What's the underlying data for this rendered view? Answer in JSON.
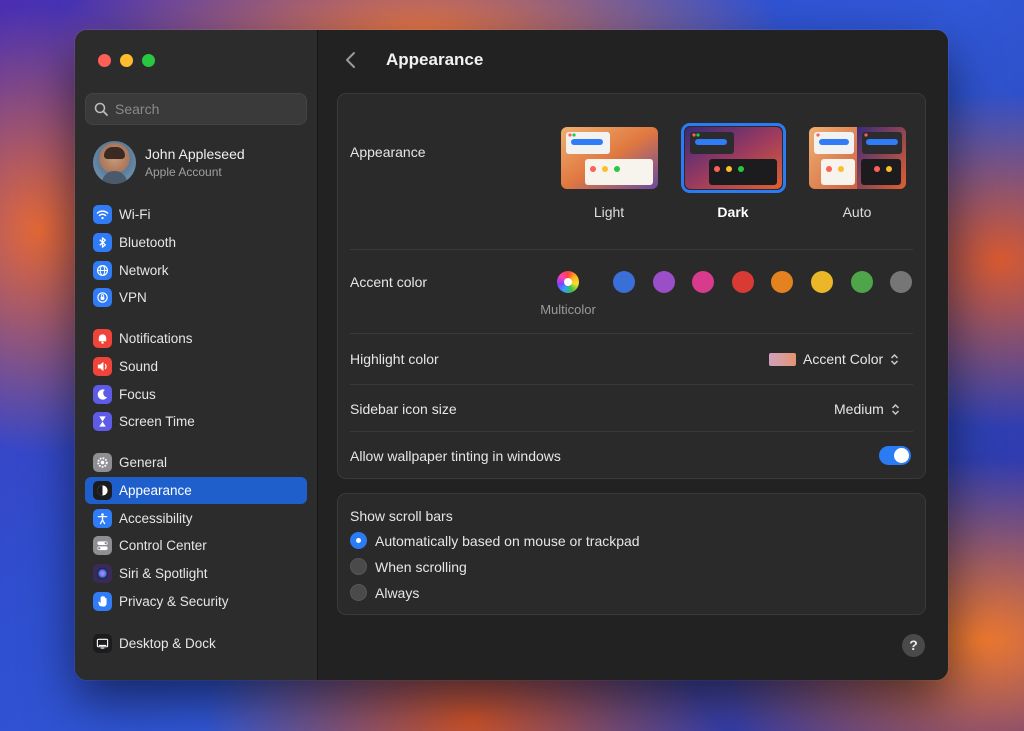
{
  "window": {
    "title": "Appearance"
  },
  "search": {
    "placeholder": "Search"
  },
  "account": {
    "name": "John Appleseed",
    "subtitle": "Apple Account"
  },
  "sidebar": {
    "group1": [
      {
        "label": "Wi-Fi",
        "icon": "wifi-icon",
        "color": "#2f7cf6"
      },
      {
        "label": "Bluetooth",
        "icon": "bluetooth-icon",
        "color": "#2f7cf6"
      },
      {
        "label": "Network",
        "icon": "globe-icon",
        "color": "#2f7cf6"
      },
      {
        "label": "VPN",
        "icon": "vpn-icon",
        "color": "#2f7cf6"
      }
    ],
    "group2": [
      {
        "label": "Notifications",
        "icon": "bell-icon",
        "color": "#f0443a"
      },
      {
        "label": "Sound",
        "icon": "speaker-icon",
        "color": "#f0443a"
      },
      {
        "label": "Focus",
        "icon": "moon-icon",
        "color": "#5e5ce6"
      },
      {
        "label": "Screen Time",
        "icon": "hourglass-icon",
        "color": "#5e5ce6"
      }
    ],
    "group3": [
      {
        "label": "General",
        "icon": "gear-icon",
        "color": "#8e8e93"
      },
      {
        "label": "Appearance",
        "icon": "appearance-icon",
        "color": "#1c1c1e",
        "active": true
      },
      {
        "label": "Accessibility",
        "icon": "accessibility-icon",
        "color": "#2f7cf6"
      },
      {
        "label": "Control Center",
        "icon": "toggles-icon",
        "color": "#8e8e93"
      },
      {
        "label": "Siri & Spotlight",
        "icon": "siri-icon",
        "color": "#3a2a5a"
      },
      {
        "label": "Privacy & Security",
        "icon": "hand-icon",
        "color": "#2f7cf6"
      }
    ],
    "group4": [
      {
        "label": "Desktop & Dock",
        "icon": "dock-icon",
        "color": "#1c1c1e"
      }
    ]
  },
  "appearance": {
    "label": "Appearance",
    "options": [
      "Light",
      "Dark",
      "Auto"
    ],
    "selected": "Dark"
  },
  "accent": {
    "label": "Accent color",
    "multicolor_label": "Multicolor",
    "colors": [
      "#3b6fd8",
      "#9a4fc9",
      "#d83b8c",
      "#d93a33",
      "#e4821f",
      "#ebb627",
      "#4ea54a",
      "#767676"
    ]
  },
  "highlight": {
    "label": "Highlight color",
    "value": "Accent Color"
  },
  "sidebar_icon_size": {
    "label": "Sidebar icon size",
    "value": "Medium"
  },
  "tinting": {
    "label": "Allow wallpaper tinting in windows",
    "enabled": true
  },
  "scroll_bars": {
    "label": "Show scroll bars",
    "options": [
      "Automatically based on mouse or trackpad",
      "When scrolling",
      "Always"
    ],
    "selected": 0
  },
  "help": {
    "label": "?"
  }
}
